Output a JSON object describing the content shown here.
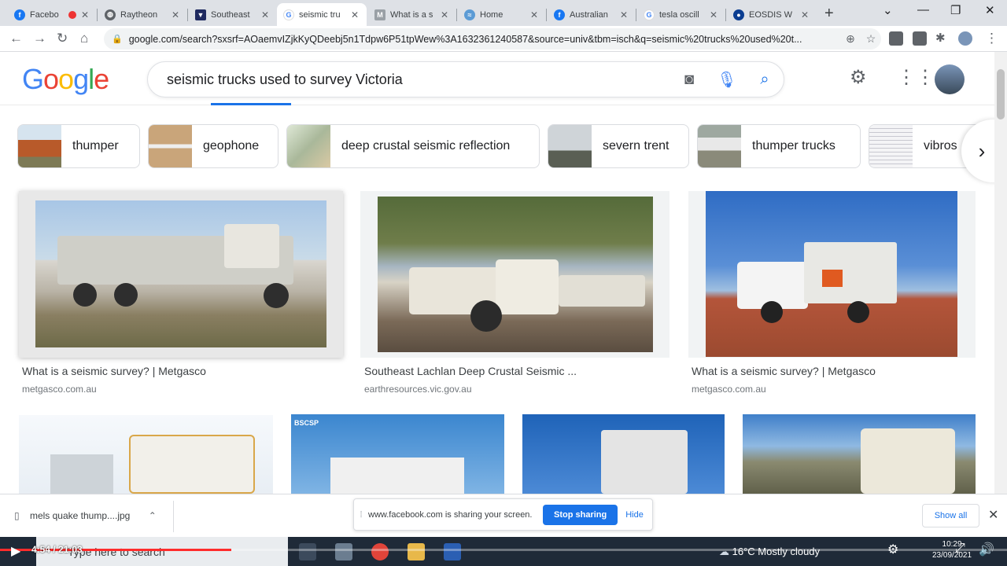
{
  "browser": {
    "tabs": [
      {
        "title": "Facebo",
        "favicon": "facebook-icon",
        "color": "#1877f2"
      },
      {
        "title": "Raytheon",
        "favicon": "globe-icon",
        "color": "#5f6368"
      },
      {
        "title": "Southeast",
        "favicon": "vic-gov-icon",
        "color": "#1f2a60"
      },
      {
        "title": "seismic tru",
        "favicon": "google-icon",
        "color": "#4285f4",
        "active": true
      },
      {
        "title": "What is a s",
        "favicon": "metgasco-icon",
        "color": "#9aa0a6"
      },
      {
        "title": "Home",
        "favicon": "home-site-icon",
        "color": "#5b9bd5"
      },
      {
        "title": "Australian",
        "favicon": "facebook-icon",
        "color": "#1877f2"
      },
      {
        "title": "tesla oscill",
        "favicon": "google-icon",
        "color": "#4285f4"
      },
      {
        "title": "EOSDIS W",
        "favicon": "nasa-icon",
        "color": "#0b3d91"
      }
    ],
    "url": "google.com/search?sxsrf=AOaemvIZjkKyQDeebj5n1Tdpw6P51tpWew%3A1632361240587&source=univ&tbm=isch&q=seismic%20trucks%20used%20t..."
  },
  "google": {
    "logo": "Google",
    "query": "seismic trucks used to survey Victoria"
  },
  "chips": [
    {
      "label": "thumper",
      "thumb": "#b85a2a"
    },
    {
      "label": "geophone",
      "thumb": "#c9a57a"
    },
    {
      "label": "deep crustal seismic reflection",
      "thumb": "#a9b89a"
    },
    {
      "label": "severn trent",
      "thumb": "#cfd4d8"
    },
    {
      "label": "thumper trucks",
      "thumb": "#9ea8a0"
    },
    {
      "label": "vibros",
      "thumb": "#e6e6ea"
    }
  ],
  "results": [
    {
      "title": "What is a seismic survey? | Metgasco",
      "source": "metgasco.com.au"
    },
    {
      "title": "Southeast Lachlan Deep Crustal Seismic ...",
      "source": "earthresources.vic.gov.au"
    },
    {
      "title": "What is a seismic survey? | Metgasco",
      "source": "metgasco.com.au"
    }
  ],
  "row2_badge": "BSCSP",
  "downloads": {
    "file": "mels quake thump....jpg",
    "share_message": "www.facebook.com is sharing your screen.",
    "stop_label": "Stop sharing",
    "hide_label": "Hide",
    "show_all": "Show all"
  },
  "taskbar": {
    "search_placeholder": "Type here to search",
    "weather": "16°C  Mostly cloudy",
    "time": "10:29",
    "date": "23/09/2021"
  },
  "video": {
    "time": "4:54 / 21:03",
    "progress": 0.23
  }
}
